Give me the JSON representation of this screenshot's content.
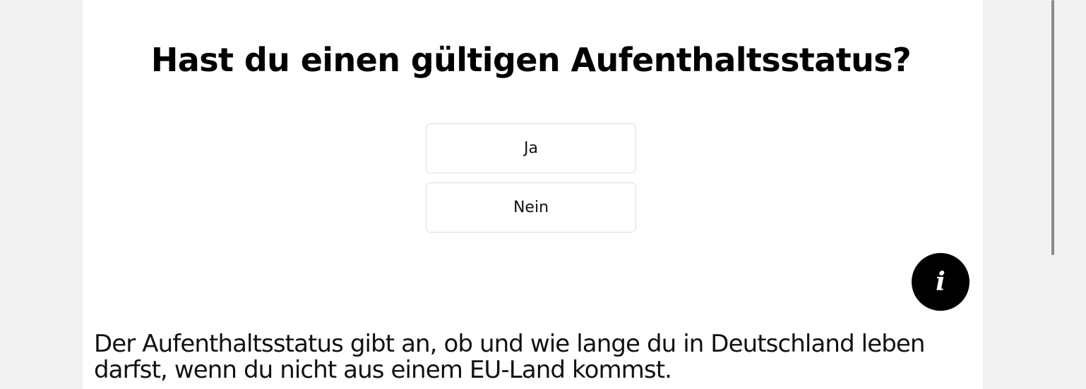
{
  "question": {
    "title": "Hast du einen gültigen Aufenthaltsstatus?"
  },
  "options": [
    {
      "label": "Ja"
    },
    {
      "label": "Nein"
    }
  ],
  "info": {
    "icon": "info-icon",
    "glyph": "i"
  },
  "description": {
    "text": "Der Aufenthaltsstatus gibt an, ob und wie lange du in Deutschland leben darfst, wenn du nicht aus einem EU-Land kommst."
  },
  "colors": {
    "page_background": "#f2f2f2",
    "panel_background": "#ffffff",
    "info_button": "#000000",
    "option_border": "#dcdcdc"
  }
}
